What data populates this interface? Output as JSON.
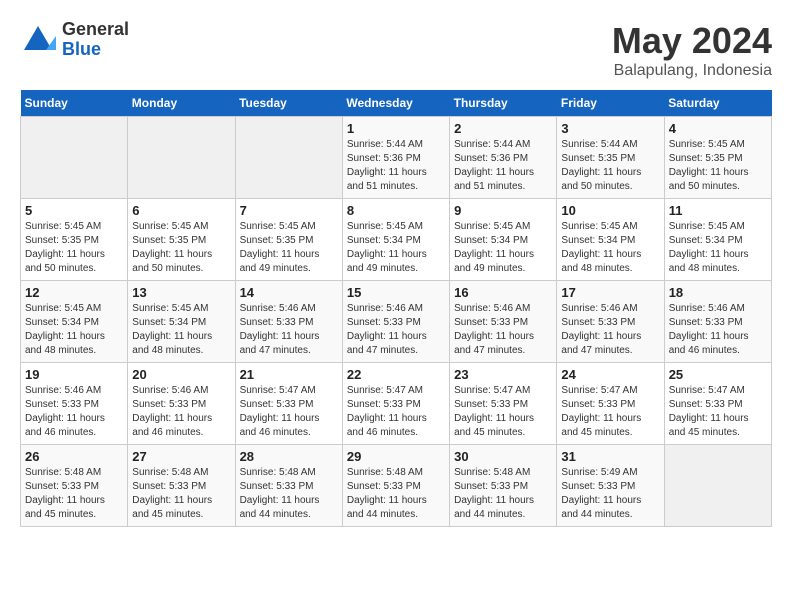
{
  "logo": {
    "general": "General",
    "blue": "Blue"
  },
  "title": "May 2024",
  "subtitle": "Balapulang, Indonesia",
  "days_header": [
    "Sunday",
    "Monday",
    "Tuesday",
    "Wednesday",
    "Thursday",
    "Friday",
    "Saturday"
  ],
  "weeks": [
    [
      {
        "day": "",
        "info": ""
      },
      {
        "day": "",
        "info": ""
      },
      {
        "day": "",
        "info": ""
      },
      {
        "day": "1",
        "info": "Sunrise: 5:44 AM\nSunset: 5:36 PM\nDaylight: 11 hours\nand 51 minutes."
      },
      {
        "day": "2",
        "info": "Sunrise: 5:44 AM\nSunset: 5:36 PM\nDaylight: 11 hours\nand 51 minutes."
      },
      {
        "day": "3",
        "info": "Sunrise: 5:44 AM\nSunset: 5:35 PM\nDaylight: 11 hours\nand 50 minutes."
      },
      {
        "day": "4",
        "info": "Sunrise: 5:45 AM\nSunset: 5:35 PM\nDaylight: 11 hours\nand 50 minutes."
      }
    ],
    [
      {
        "day": "5",
        "info": "Sunrise: 5:45 AM\nSunset: 5:35 PM\nDaylight: 11 hours\nand 50 minutes."
      },
      {
        "day": "6",
        "info": "Sunrise: 5:45 AM\nSunset: 5:35 PM\nDaylight: 11 hours\nand 50 minutes."
      },
      {
        "day": "7",
        "info": "Sunrise: 5:45 AM\nSunset: 5:35 PM\nDaylight: 11 hours\nand 49 minutes."
      },
      {
        "day": "8",
        "info": "Sunrise: 5:45 AM\nSunset: 5:34 PM\nDaylight: 11 hours\nand 49 minutes."
      },
      {
        "day": "9",
        "info": "Sunrise: 5:45 AM\nSunset: 5:34 PM\nDaylight: 11 hours\nand 49 minutes."
      },
      {
        "day": "10",
        "info": "Sunrise: 5:45 AM\nSunset: 5:34 PM\nDaylight: 11 hours\nand 48 minutes."
      },
      {
        "day": "11",
        "info": "Sunrise: 5:45 AM\nSunset: 5:34 PM\nDaylight: 11 hours\nand 48 minutes."
      }
    ],
    [
      {
        "day": "12",
        "info": "Sunrise: 5:45 AM\nSunset: 5:34 PM\nDaylight: 11 hours\nand 48 minutes."
      },
      {
        "day": "13",
        "info": "Sunrise: 5:45 AM\nSunset: 5:34 PM\nDaylight: 11 hours\nand 48 minutes."
      },
      {
        "day": "14",
        "info": "Sunrise: 5:46 AM\nSunset: 5:33 PM\nDaylight: 11 hours\nand 47 minutes."
      },
      {
        "day": "15",
        "info": "Sunrise: 5:46 AM\nSunset: 5:33 PM\nDaylight: 11 hours\nand 47 minutes."
      },
      {
        "day": "16",
        "info": "Sunrise: 5:46 AM\nSunset: 5:33 PM\nDaylight: 11 hours\nand 47 minutes."
      },
      {
        "day": "17",
        "info": "Sunrise: 5:46 AM\nSunset: 5:33 PM\nDaylight: 11 hours\nand 47 minutes."
      },
      {
        "day": "18",
        "info": "Sunrise: 5:46 AM\nSunset: 5:33 PM\nDaylight: 11 hours\nand 46 minutes."
      }
    ],
    [
      {
        "day": "19",
        "info": "Sunrise: 5:46 AM\nSunset: 5:33 PM\nDaylight: 11 hours\nand 46 minutes."
      },
      {
        "day": "20",
        "info": "Sunrise: 5:46 AM\nSunset: 5:33 PM\nDaylight: 11 hours\nand 46 minutes."
      },
      {
        "day": "21",
        "info": "Sunrise: 5:47 AM\nSunset: 5:33 PM\nDaylight: 11 hours\nand 46 minutes."
      },
      {
        "day": "22",
        "info": "Sunrise: 5:47 AM\nSunset: 5:33 PM\nDaylight: 11 hours\nand 46 minutes."
      },
      {
        "day": "23",
        "info": "Sunrise: 5:47 AM\nSunset: 5:33 PM\nDaylight: 11 hours\nand 45 minutes."
      },
      {
        "day": "24",
        "info": "Sunrise: 5:47 AM\nSunset: 5:33 PM\nDaylight: 11 hours\nand 45 minutes."
      },
      {
        "day": "25",
        "info": "Sunrise: 5:47 AM\nSunset: 5:33 PM\nDaylight: 11 hours\nand 45 minutes."
      }
    ],
    [
      {
        "day": "26",
        "info": "Sunrise: 5:48 AM\nSunset: 5:33 PM\nDaylight: 11 hours\nand 45 minutes."
      },
      {
        "day": "27",
        "info": "Sunrise: 5:48 AM\nSunset: 5:33 PM\nDaylight: 11 hours\nand 45 minutes."
      },
      {
        "day": "28",
        "info": "Sunrise: 5:48 AM\nSunset: 5:33 PM\nDaylight: 11 hours\nand 44 minutes."
      },
      {
        "day": "29",
        "info": "Sunrise: 5:48 AM\nSunset: 5:33 PM\nDaylight: 11 hours\nand 44 minutes."
      },
      {
        "day": "30",
        "info": "Sunrise: 5:48 AM\nSunset: 5:33 PM\nDaylight: 11 hours\nand 44 minutes."
      },
      {
        "day": "31",
        "info": "Sunrise: 5:49 AM\nSunset: 5:33 PM\nDaylight: 11 hours\nand 44 minutes."
      },
      {
        "day": "",
        "info": ""
      }
    ]
  ]
}
